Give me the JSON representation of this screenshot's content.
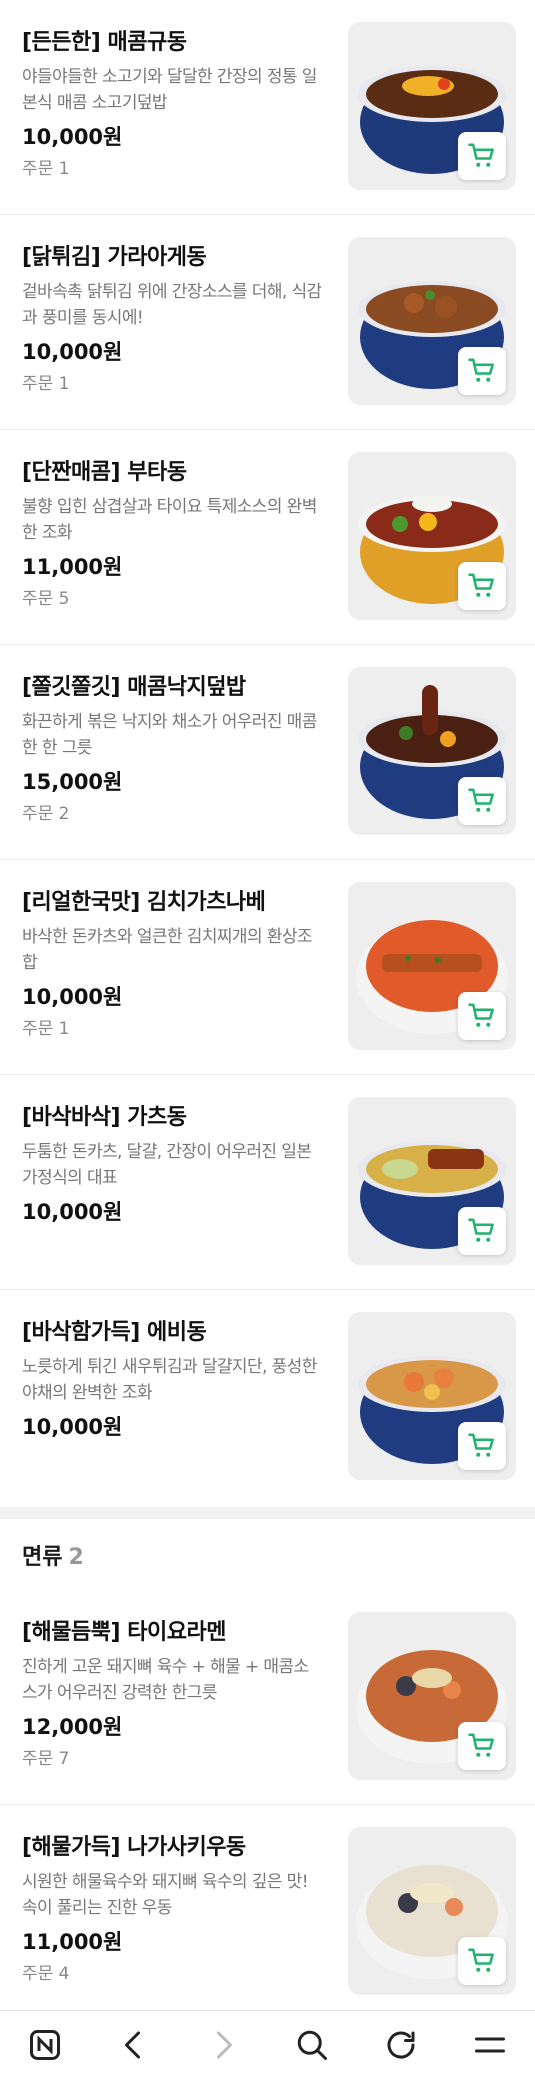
{
  "items_group_1": [
    {
      "title": "[든든한] 매콤규동",
      "desc": "야들야들한 소고기와 달달한 간장의 정통 일본식 매콤 소고기덮밥",
      "price": "10,000원",
      "orders": "주문 1"
    },
    {
      "title": "[닭튀김] 가라아게동",
      "desc": "겉바속촉 닭튀김 위에 간장소스를 더해, 식감과 풍미를 동시에!",
      "price": "10,000원",
      "orders": "주문 1"
    },
    {
      "title": "[단짠매콤] 부타동",
      "desc": "불향 입힌 삼겹살과 타이요 특제소스의 완벽한 조화",
      "price": "11,000원",
      "orders": "주문 5"
    },
    {
      "title": "[쫄깃쫄깃] 매콤낙지덮밥",
      "desc": "화끈하게 볶은 낙지와 채소가 어우러진 매콤한 한 그릇",
      "price": "15,000원",
      "orders": "주문 2"
    },
    {
      "title": "[리얼한국맛] 김치가츠나베",
      "desc": "바삭한 돈카츠와 얼큰한 김치찌개의 환상조합",
      "price": "10,000원",
      "orders": "주문 1"
    },
    {
      "title": "[바삭바삭] 가츠동",
      "desc": "두툼한 돈카츠, 달걀, 간장이 어우러진 일본 가정식의 대표",
      "price": "10,000원",
      "orders": ""
    },
    {
      "title": "[바삭함가득] 에비동",
      "desc": "노릇하게 튀긴 새우튀김과 달걀지단, 풍성한 야채의 완벽한 조화",
      "price": "10,000원",
      "orders": ""
    }
  ],
  "section_noodles": {
    "title": "면류",
    "count": "2"
  },
  "items_group_2": [
    {
      "title": "[해물듬뿍] 타이요라멘",
      "desc": "진하게 고운 돼지뼈 육수 + 해물 + 매콤소스가 어우러진 강력한 한그릇",
      "price": "12,000원",
      "orders": "주문 7"
    },
    {
      "title": "[해물가득] 나가사키우동",
      "desc": "시원한 해물육수와 돼지뼈 육수의 깊은 맛! 속이 풀리는 진한 우동",
      "price": "11,000원",
      "orders": "주문 4"
    }
  ],
  "icons": {
    "cart": "cart-icon",
    "nav": [
      "naver-home-icon",
      "back-icon",
      "forward-icon",
      "search-icon",
      "refresh-icon",
      "menu-icon"
    ]
  },
  "colors": {
    "accent_green": "#1fb36b",
    "text_gray": "#777777",
    "divider": "#f2f2f2"
  }
}
